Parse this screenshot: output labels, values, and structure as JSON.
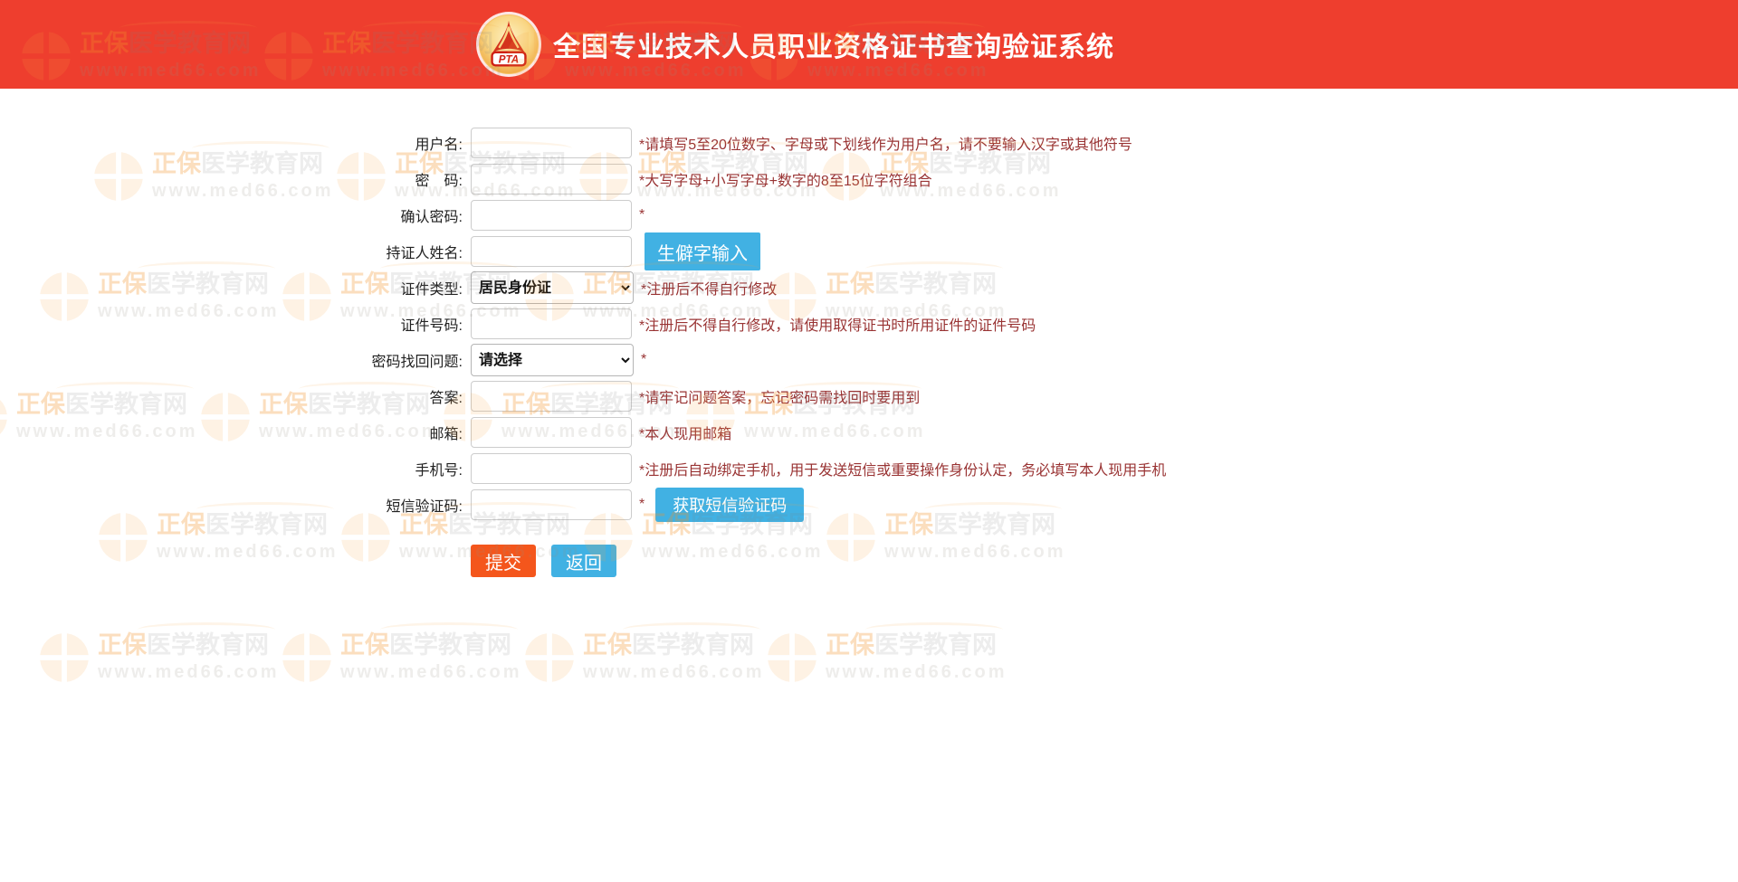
{
  "header": {
    "title": "全国专业技术人员职业资格证书查询验证系统",
    "logo_text": "PTA"
  },
  "form": {
    "rows": [
      {
        "label": "用户名:",
        "hint": "*请填写5至20位数字、字母或下划线作为用户名，请不要输入汉字或其他符号"
      },
      {
        "label": "密　码:",
        "hint": "*大写字母+小写字母+数字的8至15位字符组合"
      },
      {
        "label": "确认密码:",
        "hint": "*"
      },
      {
        "label": "持证人姓名:",
        "button": "生僻字输入"
      },
      {
        "label": "证件类型:",
        "select": "居民身份证",
        "hint": "*注册后不得自行修改"
      },
      {
        "label": "证件号码:",
        "hint": "*注册后不得自行修改，请使用取得证书时所用证件的证件号码"
      },
      {
        "label": "密码找回问题:",
        "select": "请选择",
        "hint": "*"
      },
      {
        "label": "答案:",
        "hint": "*请牢记问题答案，忘记密码需找回时要用到"
      },
      {
        "label": "邮箱:",
        "hint": "*本人现用邮箱"
      },
      {
        "label": "手机号:",
        "hint": "*注册后自动绑定手机，用于发送短信或重要操作身份认定，务必填写本人现用手机"
      },
      {
        "label": "短信验证码:",
        "hint": "*",
        "button": "获取短信验证码"
      }
    ],
    "submit_label": "提交",
    "back_label": "返回"
  },
  "watermark": {
    "brand": "正保",
    "site": "医学教育网",
    "url": "www.med66.com"
  },
  "colors": {
    "header_red": "#ee3e2e",
    "button_blue": "#41b1e3",
    "submit_orange": "#f4561c",
    "hint_red": "#993333",
    "watermark_orange": "#f5a040"
  }
}
